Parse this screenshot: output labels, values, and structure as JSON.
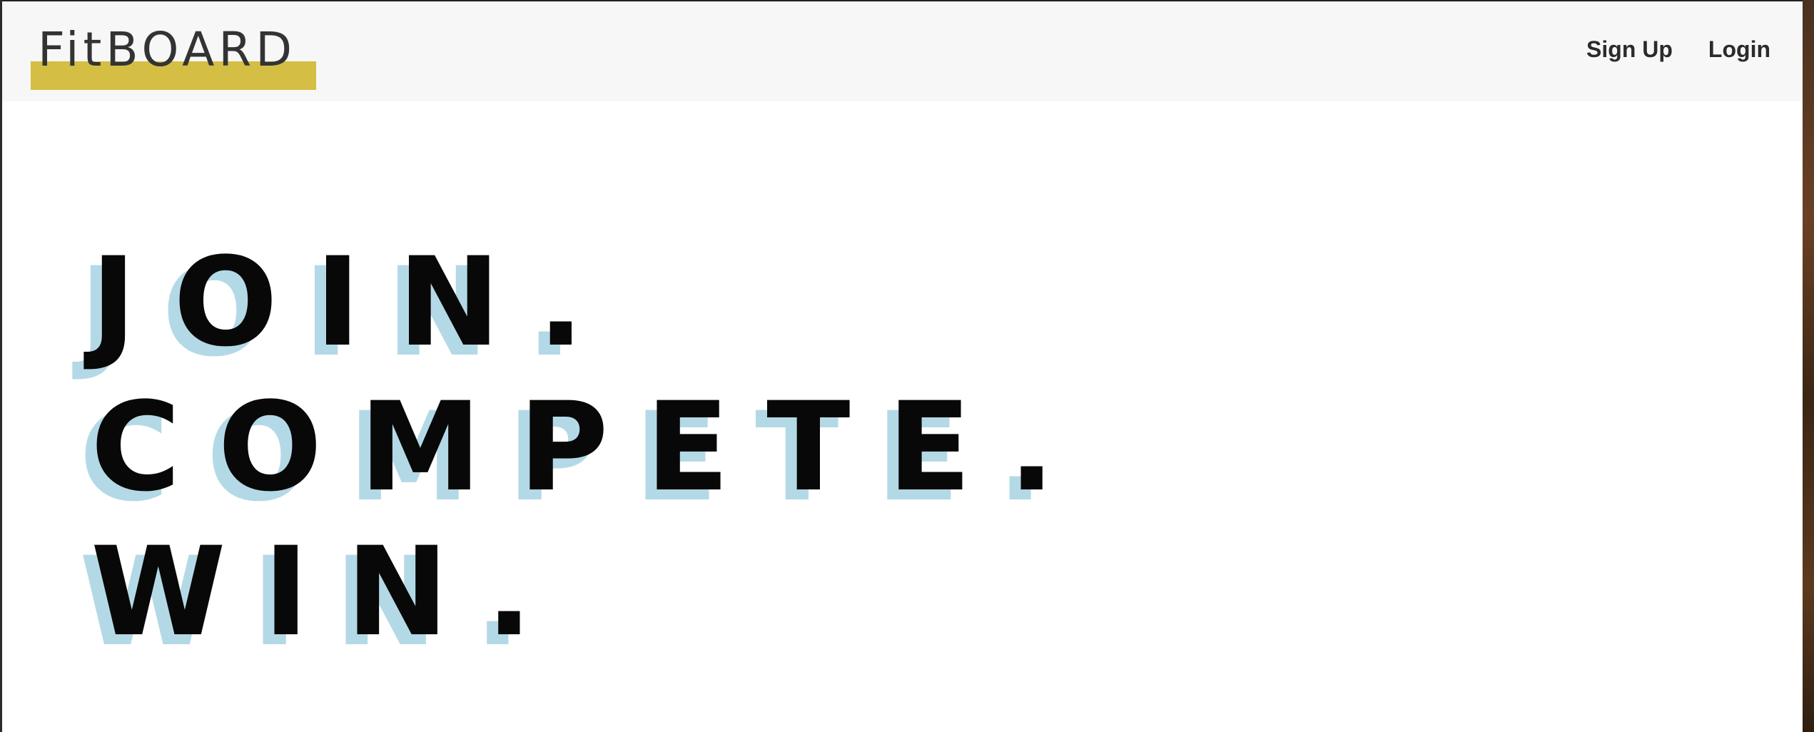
{
  "brand": {
    "name": "FitBOARD",
    "highlight_color": "#d4be44"
  },
  "nav": {
    "items": [
      {
        "label": "Sign Up"
      },
      {
        "label": "Login"
      }
    ]
  },
  "hero": {
    "lines": [
      "JOIN.",
      "COMPETE.",
      "WIN."
    ],
    "text_color": "#080808",
    "shadow_color": "#b4d9e6"
  }
}
